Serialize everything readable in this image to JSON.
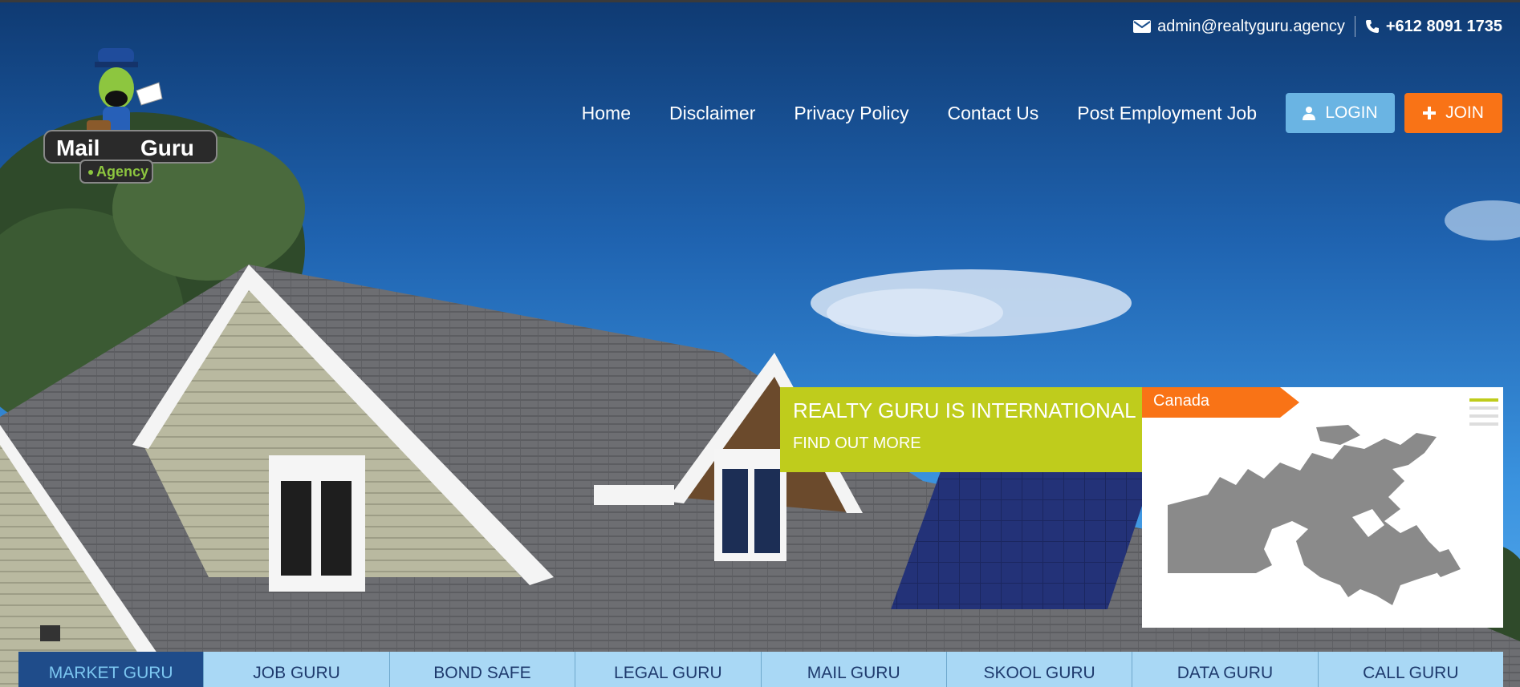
{
  "contact": {
    "email": "admin@realtyguru.agency",
    "phone": "+612 8091 1735"
  },
  "logo": {
    "word1": "Mail",
    "word2": "Guru",
    "tagline": "Agency"
  },
  "nav": {
    "links": [
      "Home",
      "Disclaimer",
      "Privacy Policy",
      "Contact Us",
      "Post Employment Job"
    ],
    "login": "LOGIN",
    "join": "JOIN"
  },
  "banner": {
    "title": "REALTY GURU IS INTERNATIONAL",
    "cta": "FIND OUT MORE"
  },
  "map": {
    "country": "Canada"
  },
  "tabs": [
    "MARKET GURU",
    "JOB GURU",
    "BOND SAFE",
    "LEGAL GURU",
    "MAIL GURU",
    "SKOOL GURU",
    "DATA GURU",
    "CALL GURU"
  ],
  "colors": {
    "accent_green": "#bfcc1c",
    "accent_orange": "#f97316",
    "login_blue": "#6ab4e3",
    "tab_blue": "#a9d8f5",
    "tab_active": "#1f4c8a"
  }
}
